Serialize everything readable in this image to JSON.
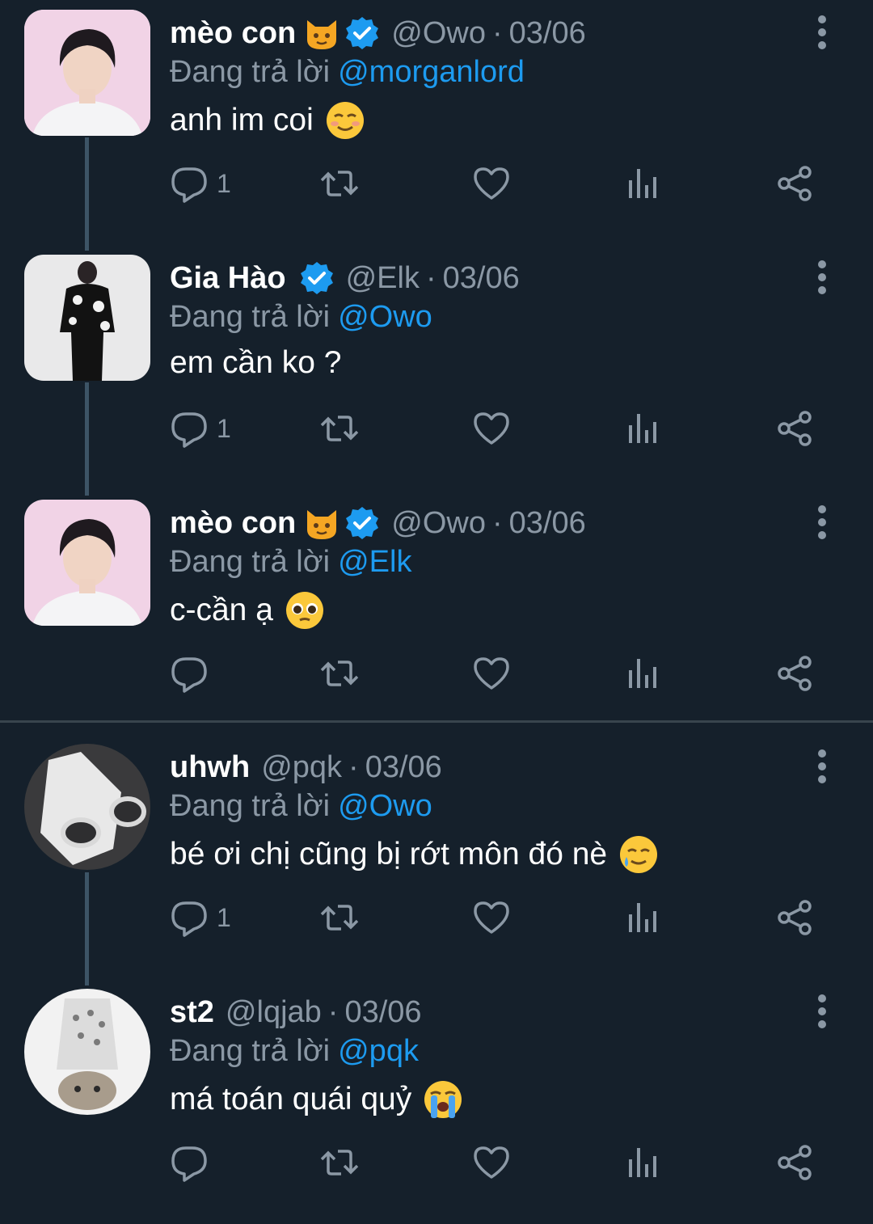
{
  "colors": {
    "background": "#15202b",
    "muted": "#8b98a5",
    "accent": "#1d9bf0",
    "thread_line": "#3d5466",
    "divider": "#38444d"
  },
  "reply_prefix": "Đang trả lời",
  "tweets": [
    {
      "name": "mèo con",
      "name_emoji": "cat-face-emoji",
      "verified": true,
      "handle": "@Owo",
      "dot": "·",
      "date": "03/06",
      "reply_to": "@morganlord",
      "text": "anh im coi",
      "text_emoji": "smiling-blush-emoji",
      "reply_count": "1",
      "avatar": "avatar-boy-pink-background"
    },
    {
      "name": "Gia Hào",
      "name_emoji": "",
      "verified": true,
      "handle": "@Elk",
      "dot": "·",
      "date": "03/06",
      "reply_to": "@Owo",
      "text": "em cần ko ?",
      "text_emoji": "",
      "reply_count": "1",
      "avatar": "avatar-person-black-shirt"
    },
    {
      "name": "mèo con",
      "name_emoji": "cat-face-emoji",
      "verified": true,
      "handle": "@Owo",
      "dot": "·",
      "date": "03/06",
      "reply_to": "@Elk",
      "text": "c-cần ạ",
      "text_emoji": "pleading-face-emoji",
      "reply_count": "",
      "avatar": "avatar-boy-pink-background"
    },
    {
      "name": "uhwh",
      "name_emoji": "",
      "verified": false,
      "handle": "@pqk",
      "dot": "·",
      "date": "03/06",
      "reply_to": "@Owo",
      "text": "bé ơi chị cũng bị rớt môn đó nè",
      "text_emoji": "smiling-tear-emoji",
      "reply_count": "1",
      "avatar": "avatar-cat-with-glasses"
    },
    {
      "name": "st2",
      "name_emoji": "",
      "verified": false,
      "handle": "@lqjab",
      "dot": "·",
      "date": "03/06",
      "reply_to": "@pqk",
      "text": "má toán quái quỷ",
      "text_emoji": "loudly-crying-emoji",
      "reply_count": "",
      "avatar": "avatar-cat-with-hat"
    }
  ]
}
